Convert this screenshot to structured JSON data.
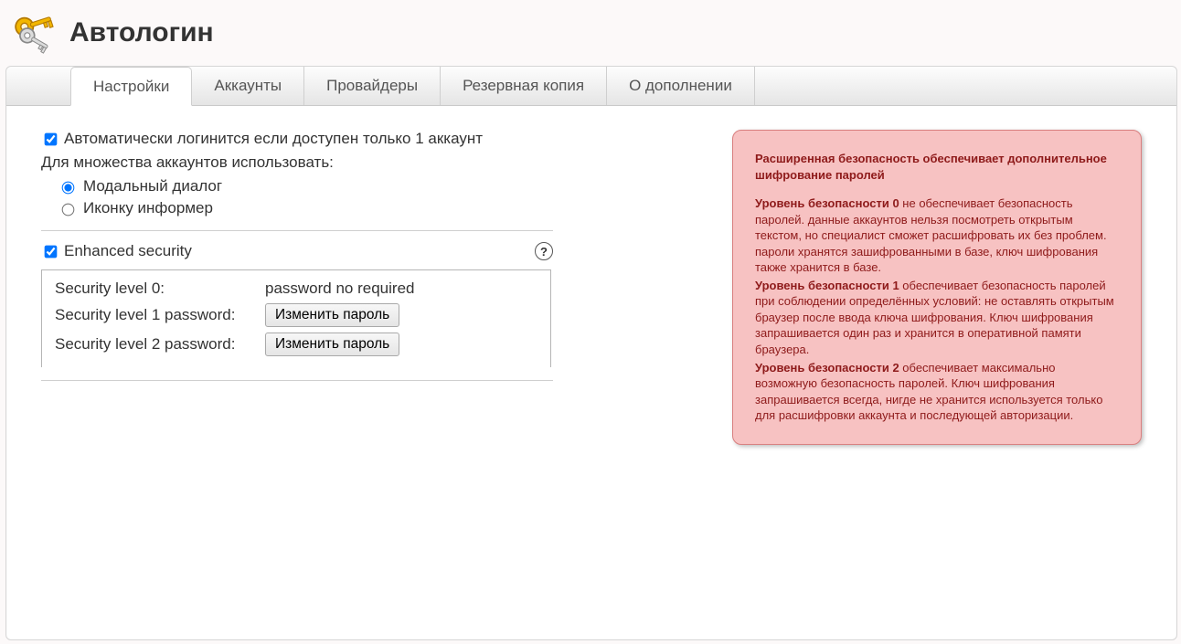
{
  "app": {
    "title": "Автологин"
  },
  "tabs": [
    {
      "label": "Настройки",
      "active": true
    },
    {
      "label": "Аккаунты",
      "active": false
    },
    {
      "label": "Провайдеры",
      "active": false
    },
    {
      "label": "Резервная копия",
      "active": false
    },
    {
      "label": "О дополнении",
      "active": false
    }
  ],
  "settings": {
    "auto_login_single": {
      "label": "Автоматически логинится если доступен только 1 аккаунт",
      "checked": true
    },
    "multi_account_prompt": "Для множества аккаунтов использовать:",
    "multi_account_mode": "modal",
    "multi_account_options": {
      "modal": "Модальный диалог",
      "informer": "Иконку информер"
    },
    "enhanced_security": {
      "label": "Enhanced security",
      "checked": true,
      "levels": {
        "l0_label": "Security level 0:",
        "l0_value": "password no required",
        "l1_label": "Security level 1 password:",
        "l1_button": "Изменить пароль",
        "l2_label": "Security level 2 password:",
        "l2_button": "Изменить пароль"
      }
    }
  },
  "tooltip": {
    "intro": "Расширенная безопасность обеспечивает дополнительное шифрование паролей",
    "l0_head": "Уровень безопасности 0",
    "l0_body": " не обеспечивает безопасность паролей. данные аккаунтов нельзя посмотреть открытым текстом, но специалист сможет расшифровать их без проблем. пароли хранятся зашифрованными в базе, ключ шифрования также хранится в базе.",
    "l1_head": "Уровень безопасности 1",
    "l1_body": " обеспечивает безопасность паролей при соблюдении определённых условий: не оставлять открытым браузер после ввода ключа шифрования. Ключ шифрования запрашивается один раз и хранится в оперативной памяти браузера.",
    "l2_head": "Уровень безопасности 2",
    "l2_body": " обеспечивает максимально возможную безопасность паролей. Ключ шифрования запрашивается всегда, нигде не хранится используется только для расшифровки аккаунта и последующей авторизации."
  }
}
